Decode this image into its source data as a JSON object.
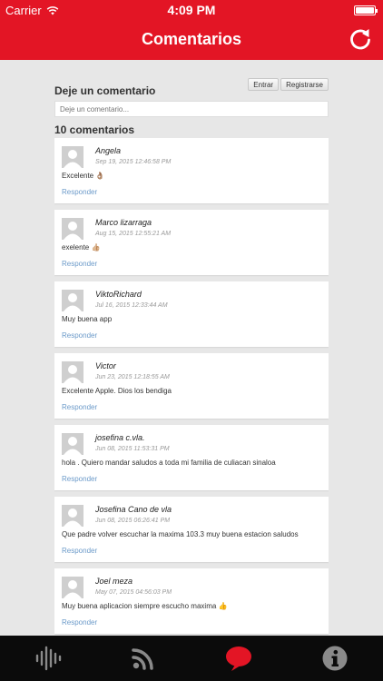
{
  "status_bar": {
    "carrier": "Carrier",
    "time": "4:09 PM"
  },
  "nav": {
    "title": "Comentarios"
  },
  "comment_form": {
    "section_title": "Deje un comentario",
    "login_label": "Entrar",
    "register_label": "Registrarse",
    "placeholder": "Deje un comentario..."
  },
  "comments_section": {
    "count_label": "10 comentarios",
    "items": [
      {
        "author": "Angela",
        "date": "Sep 19, 2015 12:46:58 PM",
        "text": "Excelente 👌🏽",
        "reply": "Responder"
      },
      {
        "author": "Marco lizarraga",
        "date": "Aug 15, 2015 12:55:21 AM",
        "text": "exelente 👍🏼",
        "reply": "Responder"
      },
      {
        "author": "ViktoRichard",
        "date": "Jul 16, 2015 12:33:44 AM",
        "text": "Muy buena app",
        "reply": "Responder"
      },
      {
        "author": "Victor",
        "date": "Jun 23, 2015 12:18:55 AM",
        "text": "Excelente Apple. Dios los bendiga",
        "reply": "Responder"
      },
      {
        "author": "josefina c.vla.",
        "date": "Jun 08, 2015 11:53:31 PM",
        "text": "hola . Quiero mandar saludos a toda mi familia de culiacan sinaloa",
        "reply": "Responder"
      },
      {
        "author": "Josefina Cano de vla",
        "date": "Jun 08, 2015 06:26:41 PM",
        "text": "Que padre volver escuchar la maxima 103.3 muy buena estacion saludos",
        "reply": "Responder"
      },
      {
        "author": "Joel meza",
        "date": "May 07, 2015 04:56:03 PM",
        "text": "Muy buena aplicacion siempre escucho maxima 👍",
        "reply": "Responder"
      }
    ]
  },
  "tab_bar": {
    "tabs": [
      "audio-waves-icon",
      "rss-feed-icon",
      "chat-bubble-icon",
      "info-icon"
    ],
    "active": "chat-bubble-icon"
  },
  "colors": {
    "brand": "#e31525",
    "tab_bar": "#0b0b0b",
    "active_tab": "#e31525",
    "inactive_tab": "#8a8a8a",
    "link": "#6b9ac9"
  }
}
